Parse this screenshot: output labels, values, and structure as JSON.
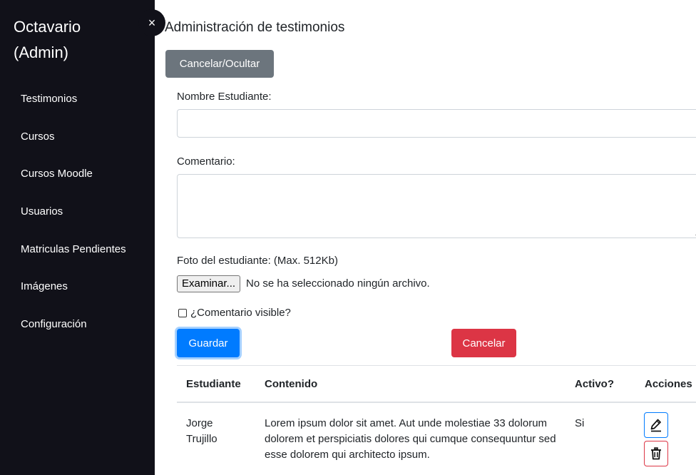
{
  "sidebar": {
    "brand_line1": "Octavario",
    "brand_line2": "(Admin)",
    "close_glyph": "×",
    "items": [
      {
        "label": "Testimonios"
      },
      {
        "label": "Cursos"
      },
      {
        "label": "Cursos Moodle"
      },
      {
        "label": "Usuarios"
      },
      {
        "label": "Matriculas Pendientes"
      },
      {
        "label": "Imágenes"
      },
      {
        "label": "Configuración"
      }
    ]
  },
  "main": {
    "title": "Administración de testimonios",
    "hide_button": "Cancelar/Ocultar",
    "form": {
      "name_label": "Nombre Estudiante:",
      "name_value": "",
      "comment_label": "Comentario:",
      "comment_value": "",
      "photo_label": "Foto del estudiante: (Max. 512Kb)",
      "file_button": "Examinar...",
      "file_status": "No se ha seleccionado ningún archivo.",
      "visible_label": "¿Comentario visible?",
      "visible_checked": false,
      "save_button": "Guardar",
      "cancel_button": "Cancelar"
    },
    "table": {
      "headers": [
        "Estudiante",
        "Contenido",
        "Activo?",
        "Acciones"
      ],
      "rows": [
        {
          "student_line1": "Jorge",
          "student_line2": "Trujillo",
          "content": "Lorem ipsum dolor sit amet. Aut unde molestiae 33 dolorum dolorem et perspiciatis dolores qui cumque consequuntur sed esse dolorem qui architecto ipsum.",
          "active": "Si"
        }
      ]
    }
  },
  "colors": {
    "sidebar_bg": "#111119",
    "primary": "#007bff",
    "danger": "#dc3545",
    "secondary": "#6c757d"
  },
  "icons": {
    "edit": "pencil-icon",
    "delete": "trash-icon",
    "close": "close-icon"
  }
}
